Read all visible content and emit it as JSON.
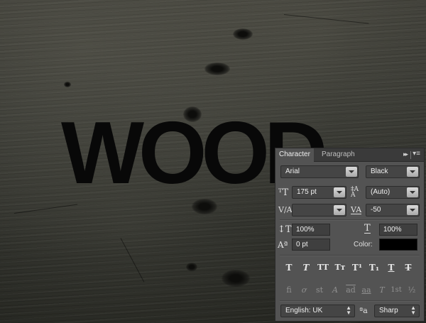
{
  "canvas": {
    "text": "WOOD"
  },
  "panel": {
    "tabs": [
      {
        "label": "Character"
      },
      {
        "label": "Paragraph"
      }
    ],
    "collapse_glyph": "▸▸",
    "menu_glyph": "▾≡",
    "font_family": "Arial",
    "font_style": "Black",
    "font_size": "175 pt",
    "leading": "(Auto)",
    "kerning": "",
    "tracking": "-50",
    "vertical_scale": "100%",
    "horizontal_scale": "100%",
    "baseline_shift": "0 pt",
    "color_label": "Color:",
    "color_value": "#000000",
    "style_buttons": [
      {
        "label": "T",
        "name": "faux-bold"
      },
      {
        "label": "T",
        "name": "faux-italic"
      },
      {
        "label": "TT",
        "name": "all-caps"
      },
      {
        "label": "Tт",
        "name": "small-caps"
      },
      {
        "label": "T¹",
        "name": "superscript"
      },
      {
        "label": "T₁",
        "name": "subscript"
      },
      {
        "label": "T",
        "name": "underline"
      },
      {
        "label": "T",
        "name": "strikethrough"
      }
    ],
    "opentype_buttons": [
      {
        "label": "fi",
        "name": "standard-ligatures"
      },
      {
        "label": "ơ",
        "name": "contextual-alternates"
      },
      {
        "label": "st",
        "name": "discretionary-ligatures"
      },
      {
        "label": "A",
        "name": "swash"
      },
      {
        "label": "ad",
        "name": "stylistic-alternates"
      },
      {
        "label": "aa",
        "name": "titling-alternates"
      },
      {
        "label": "T",
        "name": "ordinals"
      },
      {
        "label": "1st",
        "name": "ordinals-2"
      },
      {
        "label": "½",
        "name": "fractions"
      }
    ],
    "language": "English: UK",
    "aa_icon": "ªa",
    "anti_alias": "Sharp"
  }
}
